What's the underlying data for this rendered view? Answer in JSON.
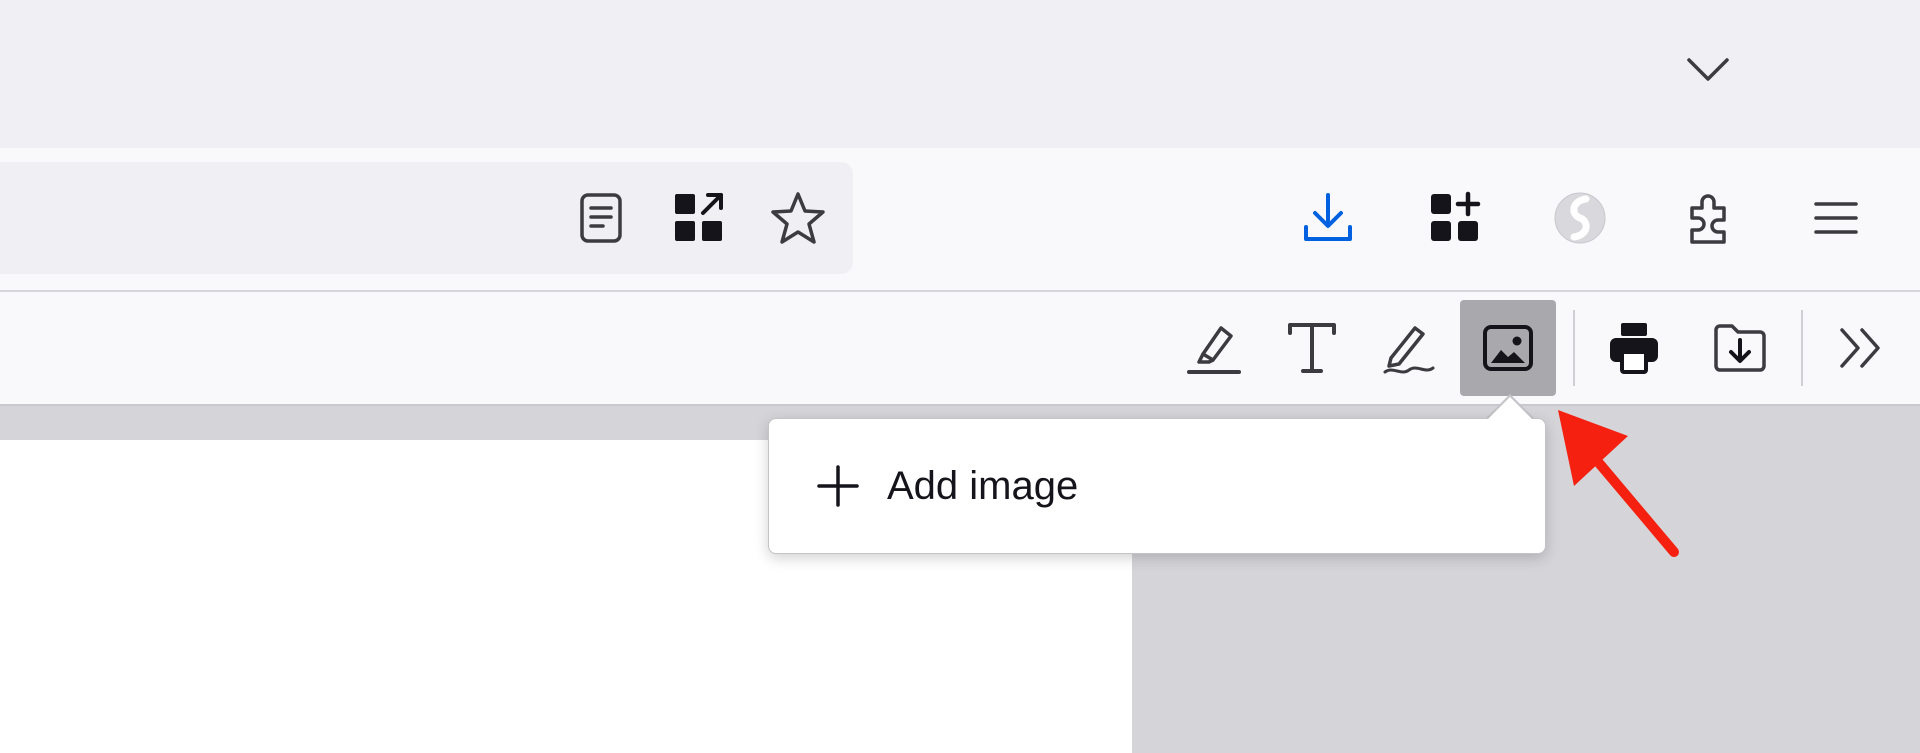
{
  "tabstrip": {
    "list_all_tabs_icon": "chevron-down-icon"
  },
  "navbar": {
    "urlbar_icons": [
      "reader-view-icon",
      "add-to-collection-icon",
      "bookmark-star-icon"
    ],
    "toolbar_icons": [
      "downloads-icon",
      "add-ons-grid-icon",
      "profile-avatar-icon",
      "extensions-puzzle-icon",
      "app-menu-icon"
    ],
    "download_color": "#0061e0"
  },
  "pdf_toolbar": {
    "tools": [
      "highlight-tool-icon",
      "text-tool-icon",
      "draw-tool-icon",
      "image-tool-icon",
      "print-icon",
      "save-icon",
      "overflow-chevrons-icon"
    ],
    "active_tool": "image-tool-icon"
  },
  "image_menu": {
    "add_image_label": "Add image"
  },
  "annotation": {
    "arrow_color": "#f5200f"
  }
}
